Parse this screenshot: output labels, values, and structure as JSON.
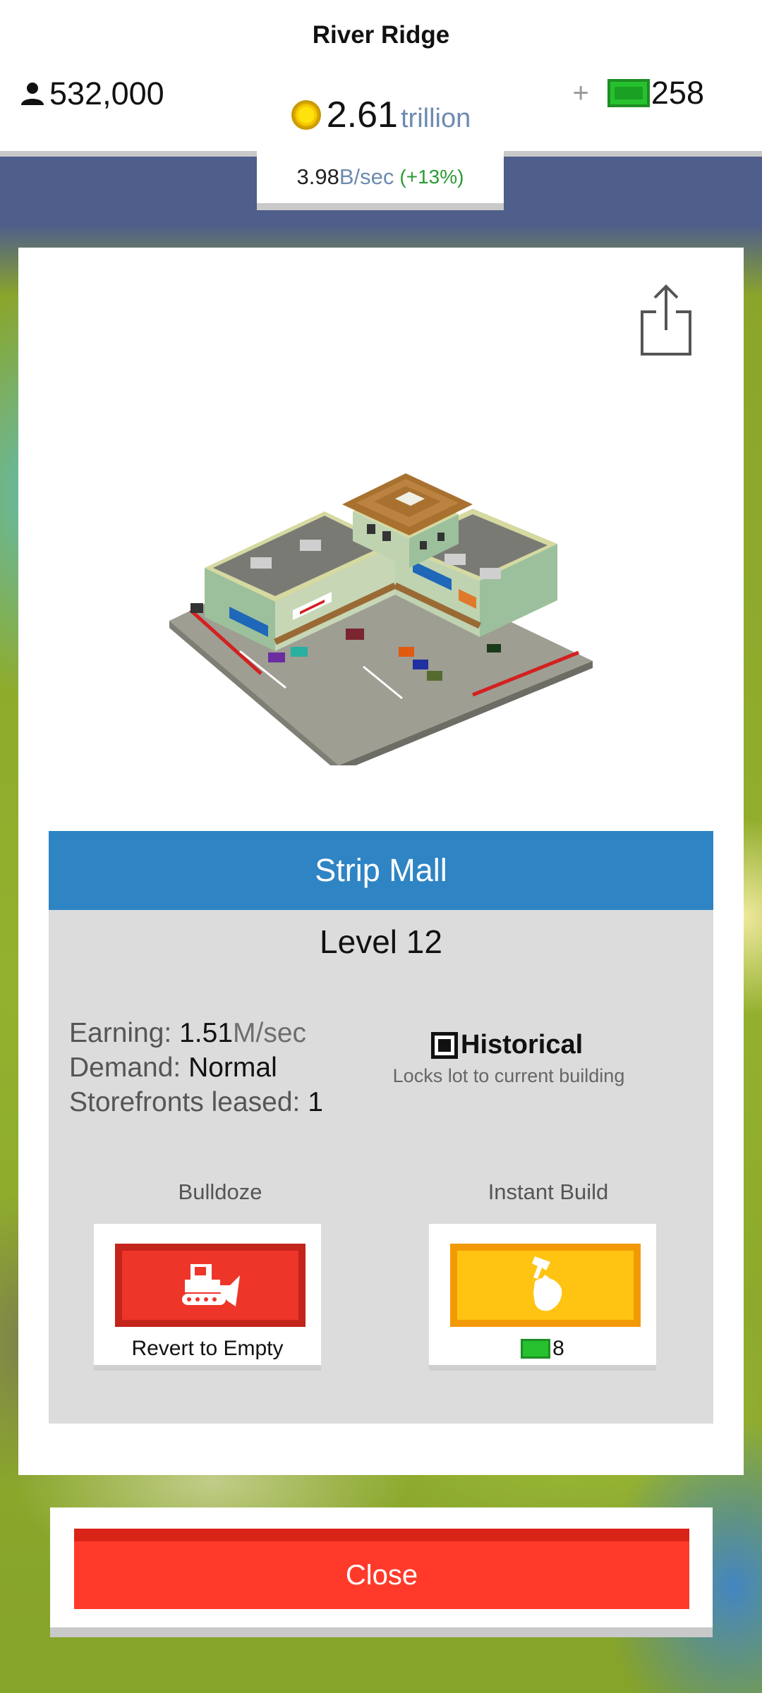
{
  "city": {
    "name": "River Ridge"
  },
  "header": {
    "population": "532,000",
    "cash": "2.61",
    "cash_unit": "trillion",
    "premium": "258",
    "plus_label": "+"
  },
  "rate": {
    "value": "3.98",
    "unit": "B/sec",
    "change": "(+13%)"
  },
  "building": {
    "name": "Strip Mall",
    "level": "Level 12",
    "stats": {
      "earning_label": "Earning:",
      "earning_value": "1.51",
      "earning_unit": "M/sec",
      "demand_label": "Demand:",
      "demand_value": "Normal",
      "storefronts_label": "Storefronts leased:",
      "storefronts_value": "1"
    },
    "historical": {
      "label": "Historical",
      "description": "Locks lot to current building",
      "checked": true
    }
  },
  "actions": {
    "bulldoze": {
      "title": "Bulldoze",
      "button_text": "Revert to Empty",
      "icon": "bulldozer-icon"
    },
    "instant_build": {
      "title": "Instant Build",
      "cost": "8",
      "icon": "hammer-hand-icon"
    }
  },
  "close": {
    "label": "Close"
  },
  "colors": {
    "title_band": "#2f84c4",
    "bulldoze": "#ee3529",
    "instant_build": "#ffc311",
    "close": "#ff3a2a",
    "rate_change": "#2c9a33"
  }
}
